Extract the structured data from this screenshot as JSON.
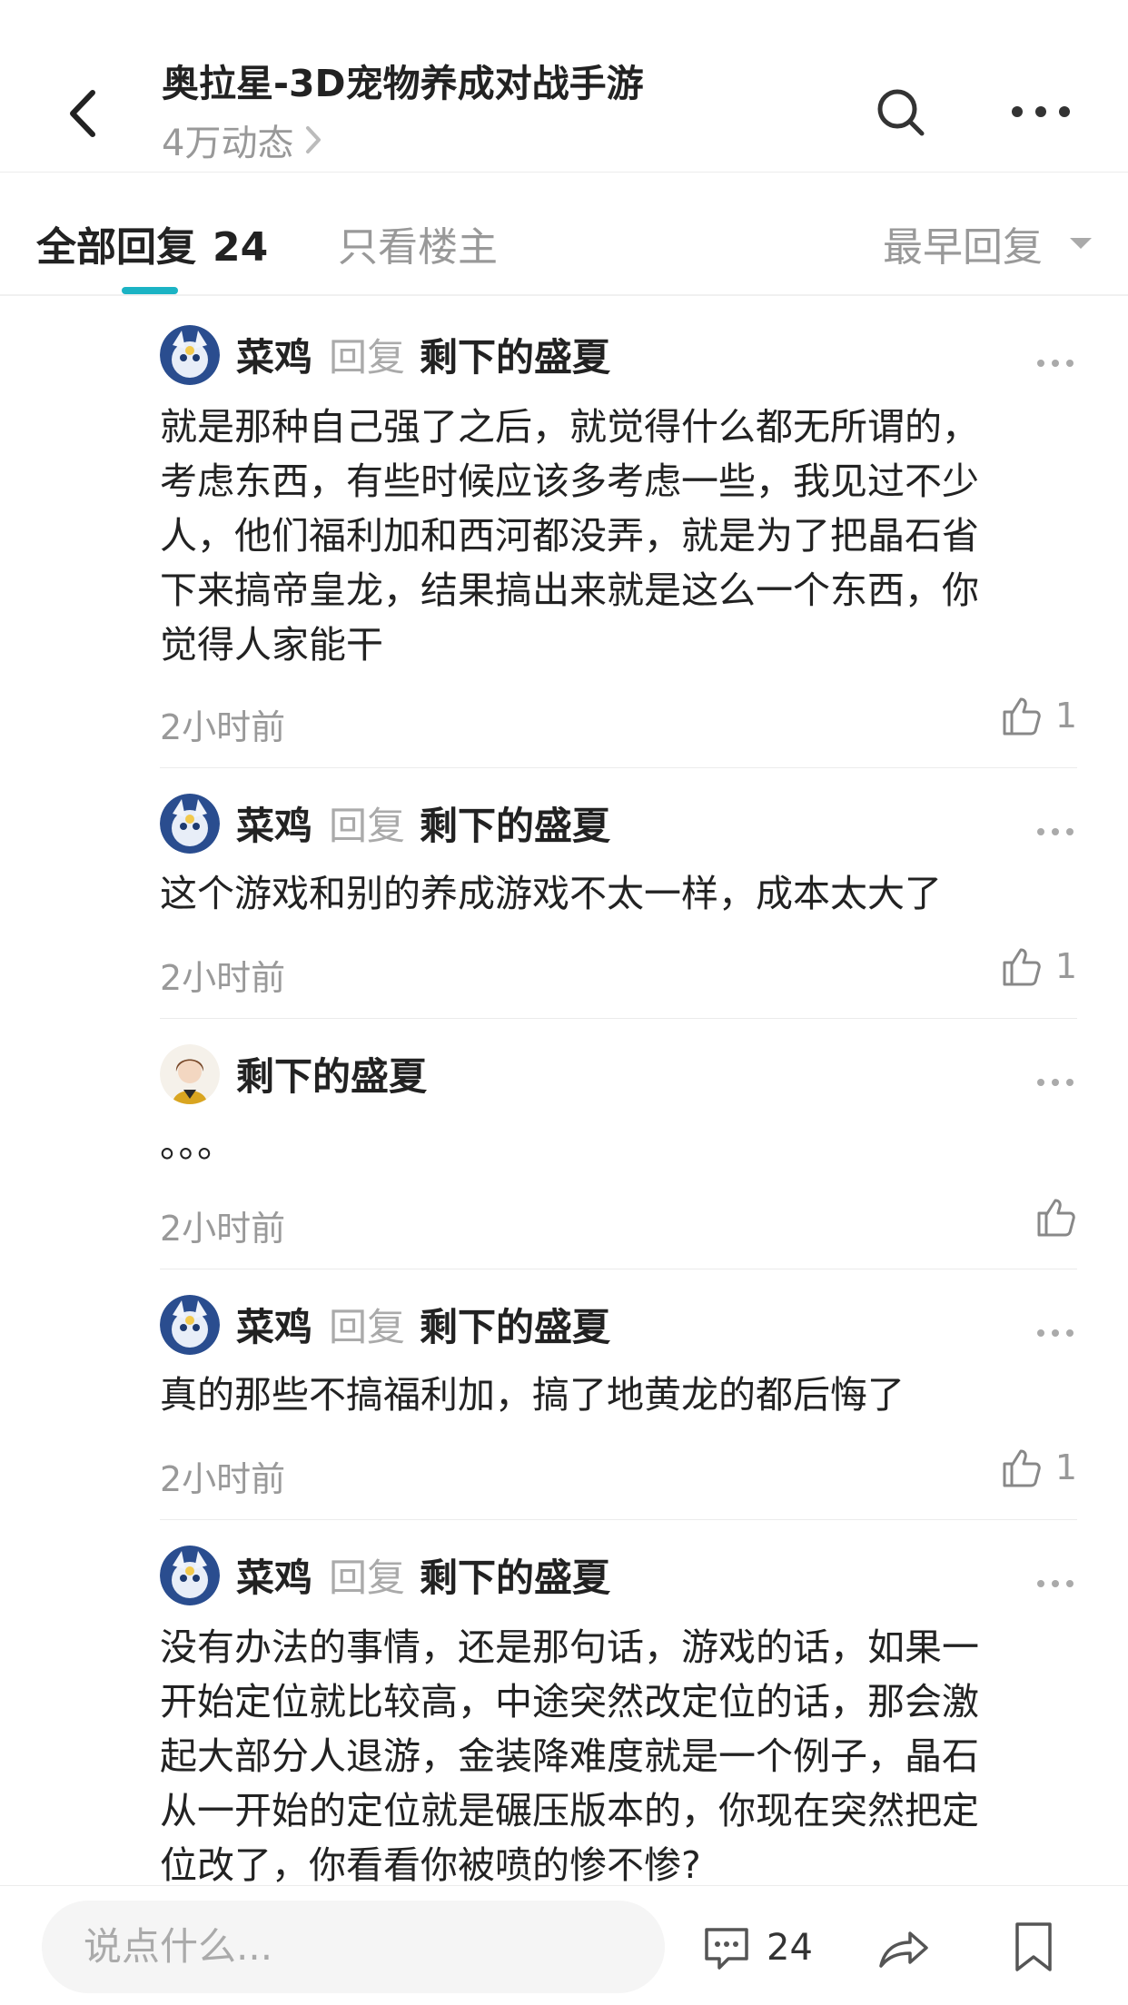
{
  "header": {
    "title": "奥拉星-3D宠物养成对战手游",
    "subtitle": "4万动态"
  },
  "tabs": {
    "all_label": "全部回复",
    "all_count": "24",
    "owner_label": "只看楼主",
    "sort_label": "最早回复"
  },
  "replies": [
    {
      "user": "菜鸡",
      "reply_word": "回复",
      "target": "剩下的盛夏",
      "lines": [
        "就是那种自己强了之后，就觉得什么都无所谓的，",
        "考虑东西，有些时候应该多考虑一些，我见过不少",
        "人，他们福利加和西河都没弄，就是为了把晶石省",
        "下来搞帝皇龙，结果搞出来就是这么一个东西，你",
        "觉得人家能干"
      ],
      "time": "2小时前",
      "likes": "1"
    },
    {
      "user": "菜鸡",
      "reply_word": "回复",
      "target": "剩下的盛夏",
      "lines": [
        "这个游戏和别的养成游戏不太一样，成本太大了"
      ],
      "time": "2小时前",
      "likes": "1"
    },
    {
      "user": "剩下的盛夏",
      "lines": [
        "。。。"
      ],
      "time": "2小时前"
    },
    {
      "user": "菜鸡",
      "reply_word": "回复",
      "target": "剩下的盛夏",
      "lines": [
        "真的那些不搞福利加，搞了地黄龙的都后悔了"
      ],
      "time": "2小时前",
      "likes": "1"
    },
    {
      "user": "菜鸡",
      "reply_word": "回复",
      "target": "剩下的盛夏",
      "lines": [
        "没有办法的事情，还是那句话，游戏的话，如果一",
        "开始定位就比较高，中途突然改定位的话，那会激",
        "起大部分人退游，金装降难度就是一个例子，晶石",
        "从一开始的定位就是碾压版本的，你现在突然把定",
        "位改了，你看看你被喷的惨不惨?"
      ]
    }
  ],
  "bottom": {
    "input_placeholder": "说点什么...",
    "comment_count": "24"
  },
  "icons": [
    "back-arrow-icon",
    "search-icon",
    "more-dots-icon",
    "thumbs-up-icon",
    "comment-icon",
    "share-icon",
    "bookmark-icon"
  ],
  "colors": {
    "accent": "#1bb3c4",
    "battery": "#f5c400",
    "muted_text": "#999999"
  }
}
